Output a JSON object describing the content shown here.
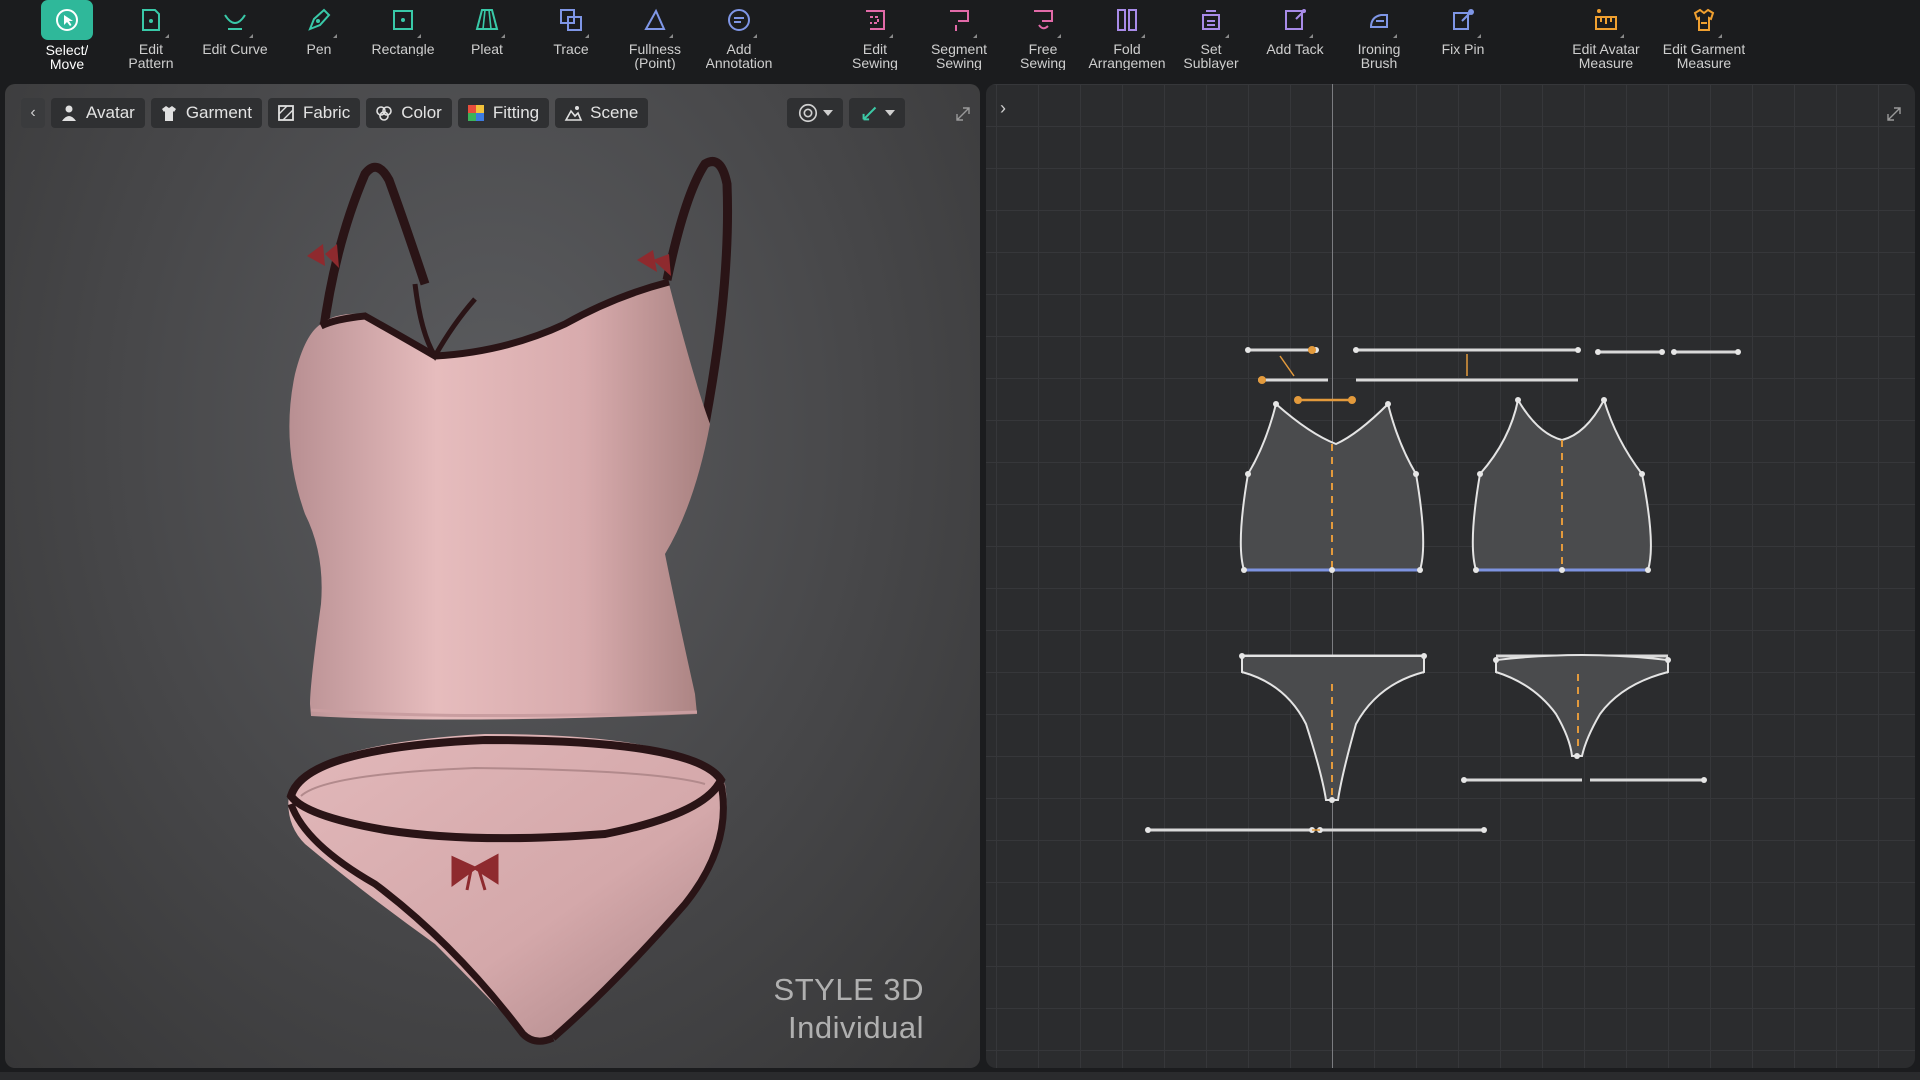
{
  "toolbar": {
    "tools": [
      {
        "label": "Select/\nMove",
        "icon": "select-move-icon",
        "color": "#ffffff",
        "active": true
      },
      {
        "label": "Edit\nPattern",
        "icon": "edit-pattern-icon",
        "color": "#39c9a8"
      },
      {
        "label": "Edit Curve",
        "icon": "edit-curve-icon",
        "color": "#39c9a8"
      },
      {
        "label": "Pen",
        "icon": "pen-icon",
        "color": "#39c9a8"
      },
      {
        "label": "Rectangle",
        "icon": "rectangle-icon",
        "color": "#39c9a8"
      },
      {
        "label": "Pleat",
        "icon": "pleat-icon",
        "color": "#39c9a8"
      },
      {
        "label": "Trace",
        "icon": "trace-icon",
        "color": "#7f96e6"
      },
      {
        "label": "Fullness\n(Point)",
        "icon": "fullness-point-icon",
        "color": "#7f96e6"
      },
      {
        "label": "Add\nAnnotation",
        "icon": "add-annotation-icon",
        "color": "#7f96e6"
      },
      {
        "label": "Edit\nSewing",
        "icon": "edit-sewing-icon",
        "color": "#e26aa8"
      },
      {
        "label": "Segment\nSewing",
        "icon": "segment-sewing-icon",
        "color": "#e26aa8"
      },
      {
        "label": "Free\nSewing",
        "icon": "free-sewing-icon",
        "color": "#e26aa8"
      },
      {
        "label": "Fold\nArrangemen",
        "icon": "fold-arrangement-icon",
        "color": "#a88be8"
      },
      {
        "label": "Set\nSublayer",
        "icon": "set-sublayer-icon",
        "color": "#a88be8"
      },
      {
        "label": "Add Tack",
        "icon": "add-tack-icon",
        "color": "#a88be8"
      },
      {
        "label": "Ironing\nBrush",
        "icon": "ironing-brush-icon",
        "color": "#7f96e6"
      },
      {
        "label": "Fix Pin",
        "icon": "fix-pin-icon",
        "color": "#7f96e6"
      },
      {
        "label": "Edit Avatar\nMeasure",
        "icon": "edit-avatar-measure-icon",
        "color": "#f0a030"
      },
      {
        "label": "Edit Garment\nMeasure",
        "icon": "edit-garment-measure-icon",
        "color": "#f0a030"
      }
    ]
  },
  "viewport3d": {
    "tabs": [
      {
        "label": "Avatar",
        "icon": "avatar-icon"
      },
      {
        "label": "Garment",
        "icon": "garment-icon"
      },
      {
        "label": "Fabric",
        "icon": "fabric-icon"
      },
      {
        "label": "Color",
        "icon": "color-icon"
      },
      {
        "label": "Fitting",
        "icon": "fitting-icon"
      },
      {
        "label": "Scene",
        "icon": "scene-icon"
      }
    ],
    "watermark_line1": "STYLE 3D",
    "watermark_line2": "Individual",
    "garment_color": "#e2b6b8",
    "trim_color": "#2a1416",
    "bow_color": "#8e2a2e"
  },
  "viewport2d": {
    "pattern_fill": "#4a4b4d",
    "seam_color": "#e39a3c",
    "hem_color": "#7d93e0"
  }
}
